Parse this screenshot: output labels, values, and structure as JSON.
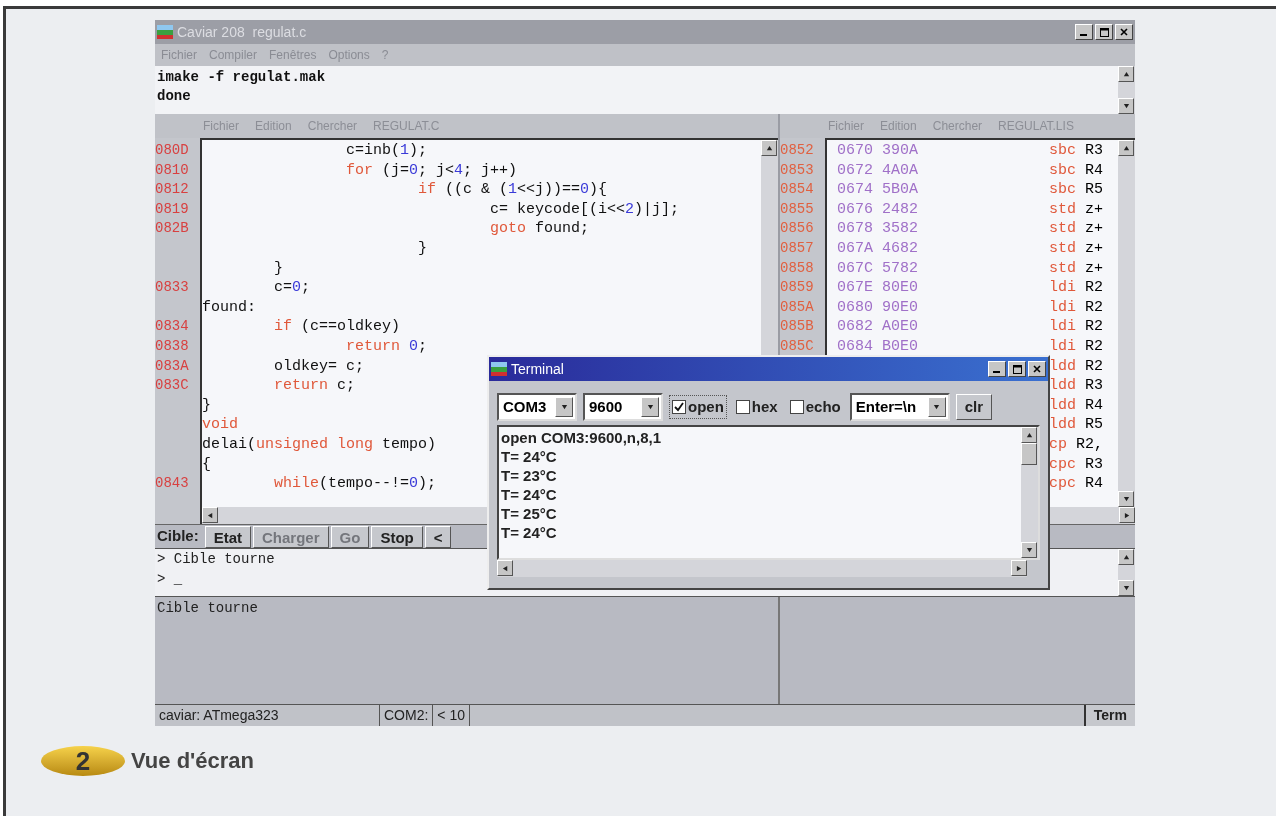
{
  "window": {
    "title": "Caviar 208  regulat.c"
  },
  "menu": [
    "Fichier",
    "Compiler",
    "Fenêtres",
    "Options",
    "?"
  ],
  "build_output": [
    "imake -f regulat.mak",
    "done"
  ],
  "editor": {
    "menu": [
      "Fichier",
      "Edition",
      "Chercher"
    ],
    "file": "REGULAT.C",
    "lines": [
      {
        "addr": "080D",
        "tokens": [
          {
            "text": "                c=inb(",
            "kind": "plain"
          },
          {
            "text": "1",
            "kind": "number"
          },
          {
            "text": ");",
            "kind": "plain"
          }
        ]
      },
      {
        "addr": "0810",
        "tokens": [
          {
            "text": "                for",
            "kind": "keyword"
          },
          {
            "text": " (j=",
            "kind": "plain"
          },
          {
            "text": "0",
            "kind": "number"
          },
          {
            "text": "; j<",
            "kind": "plain"
          },
          {
            "text": "4",
            "kind": "number"
          },
          {
            "text": "; j++)",
            "kind": "plain"
          }
        ]
      },
      {
        "addr": "0812",
        "tokens": [
          {
            "text": "                        if",
            "kind": "keyword"
          },
          {
            "text": " ((c & (",
            "kind": "plain"
          },
          {
            "text": "1",
            "kind": "number"
          },
          {
            "text": "<<j))==",
            "kind": "plain"
          },
          {
            "text": "0",
            "kind": "number"
          },
          {
            "text": "){",
            "kind": "plain"
          }
        ]
      },
      {
        "addr": "0819",
        "tokens": [
          {
            "text": "                                c= keycode[(i<<",
            "kind": "plain"
          },
          {
            "text": "2",
            "kind": "number"
          },
          {
            "text": ")|j];",
            "kind": "plain"
          }
        ]
      },
      {
        "addr": "082B",
        "tokens": [
          {
            "text": "                                goto",
            "kind": "keyword"
          },
          {
            "text": " found;",
            "kind": "plain"
          }
        ]
      },
      {
        "tokens": [
          {
            "text": "                        }",
            "kind": "plain"
          }
        ]
      },
      {
        "tokens": [
          {
            "text": "        }",
            "kind": "plain"
          }
        ]
      },
      {
        "addr": "0833",
        "tokens": [
          {
            "text": "        c=",
            "kind": "plain"
          },
          {
            "text": "0",
            "kind": "number"
          },
          {
            "text": ";",
            "kind": "plain"
          }
        ]
      },
      {
        "tokens": [
          {
            "text": "found:",
            "kind": "plain"
          }
        ]
      },
      {
        "addr": "0834",
        "tokens": [
          {
            "text": "        if",
            "kind": "keyword"
          },
          {
            "text": " (c==oldkey)",
            "kind": "plain"
          }
        ]
      },
      {
        "addr": "0838",
        "tokens": [
          {
            "text": "                return",
            "kind": "keyword"
          },
          {
            "text": " 0",
            "kind": "number"
          },
          {
            "text": ";",
            "kind": "plain"
          }
        ]
      },
      {
        "addr": "083A",
        "tokens": [
          {
            "text": "        oldkey= c;",
            "kind": "plain"
          }
        ]
      },
      {
        "addr": "083C",
        "tokens": [
          {
            "text": "        return",
            "kind": "keyword"
          },
          {
            "text": " c;",
            "kind": "plain"
          }
        ]
      },
      {
        "tokens": [
          {
            "text": "}",
            "kind": "plain"
          }
        ]
      },
      {
        "tokens": [
          {
            "text": "void",
            "kind": "keyword"
          }
        ]
      },
      {
        "tokens": [
          {
            "text": "delai(",
            "kind": "plain"
          },
          {
            "text": "unsigned long",
            "kind": "keyword"
          },
          {
            "text": " tempo)",
            "kind": "plain"
          }
        ]
      },
      {
        "tokens": [
          {
            "text": "{",
            "kind": "plain"
          }
        ]
      },
      {
        "addr": "0843",
        "tokens": [
          {
            "text": "        while",
            "kind": "keyword"
          },
          {
            "text": "(tempo--!=",
            "kind": "plain"
          },
          {
            "text": "0",
            "kind": "number"
          },
          {
            "text": ");",
            "kind": "plain"
          }
        ]
      }
    ]
  },
  "listing": {
    "menu": [
      "Fichier",
      "Edition",
      "Chercher"
    ],
    "file": "REGULAT.LIS",
    "rows": [
      {
        "addr": "0852",
        "code": "0670 390A",
        "op": "sbc",
        "args": "R3"
      },
      {
        "addr": "0853",
        "code": "0672 4A0A",
        "op": "sbc",
        "args": "R4"
      },
      {
        "addr": "0854",
        "code": "0674 5B0A",
        "op": "sbc",
        "args": "R5"
      },
      {
        "addr": "0855",
        "code": "0676 2482",
        "op": "std",
        "args": "z+"
      },
      {
        "addr": "0856",
        "code": "0678 3582",
        "op": "std",
        "args": "z+"
      },
      {
        "addr": "0857",
        "code": "067A 4682",
        "op": "std",
        "args": "z+"
      },
      {
        "addr": "0858",
        "code": "067C 5782",
        "op": "std",
        "args": "z+"
      },
      {
        "addr": "0859",
        "code": "067E 80E0",
        "op": "ldi",
        "args": "R2"
      },
      {
        "addr": "085A",
        "code": "0680 90E0",
        "op": "ldi",
        "args": "R2"
      },
      {
        "addr": "085B",
        "code": "0682 A0E0",
        "op": "ldi",
        "args": "R2"
      },
      {
        "addr": "085C",
        "code": "0684 B0E0",
        "op": "ldi",
        "args": "R2"
      },
      {
        "op": "ldd",
        "args": "R2"
      },
      {
        "op": "ldd",
        "args": "R3"
      },
      {
        "op": "ldd",
        "args": "R4"
      },
      {
        "op": "ldd",
        "args": "R5"
      },
      {
        "op": "cp",
        "args": "R2,"
      },
      {
        "op": "cpc",
        "args": "R3"
      },
      {
        "op": "cpc",
        "args": "R4"
      }
    ]
  },
  "toolbar": {
    "label": "Cible:",
    "buttons": [
      {
        "label": "Etat",
        "disabled": false
      },
      {
        "label": "Charger",
        "disabled": true
      },
      {
        "label": "Go",
        "disabled": true
      },
      {
        "label": "Stop",
        "disabled": false
      },
      {
        "label": "<",
        "disabled": false
      }
    ]
  },
  "console": [
    "> Cible tourne",
    "> _"
  ],
  "messages": [
    "Cible tourne"
  ],
  "status_bar": {
    "fields": [
      "caviar: ATmega323",
      "COM2:",
      "< 10"
    ],
    "button": "Term"
  },
  "terminal": {
    "title": "Terminal",
    "port": "COM3",
    "baud": "9600",
    "checkboxes": [
      {
        "label": "open",
        "checked": true
      },
      {
        "label": "hex",
        "checked": false
      },
      {
        "label": "echo",
        "checked": false
      }
    ],
    "enter_mode": "Enter=\\n",
    "clear_button": "clr",
    "output": [
      "open COM3:9600,n,8,1",
      "T= 24°C",
      "T= 23°C",
      "T= 24°C",
      "T= 25°C",
      "T= 24°C"
    ]
  },
  "caption": {
    "number": "2",
    "text": "Vue d'écran"
  }
}
